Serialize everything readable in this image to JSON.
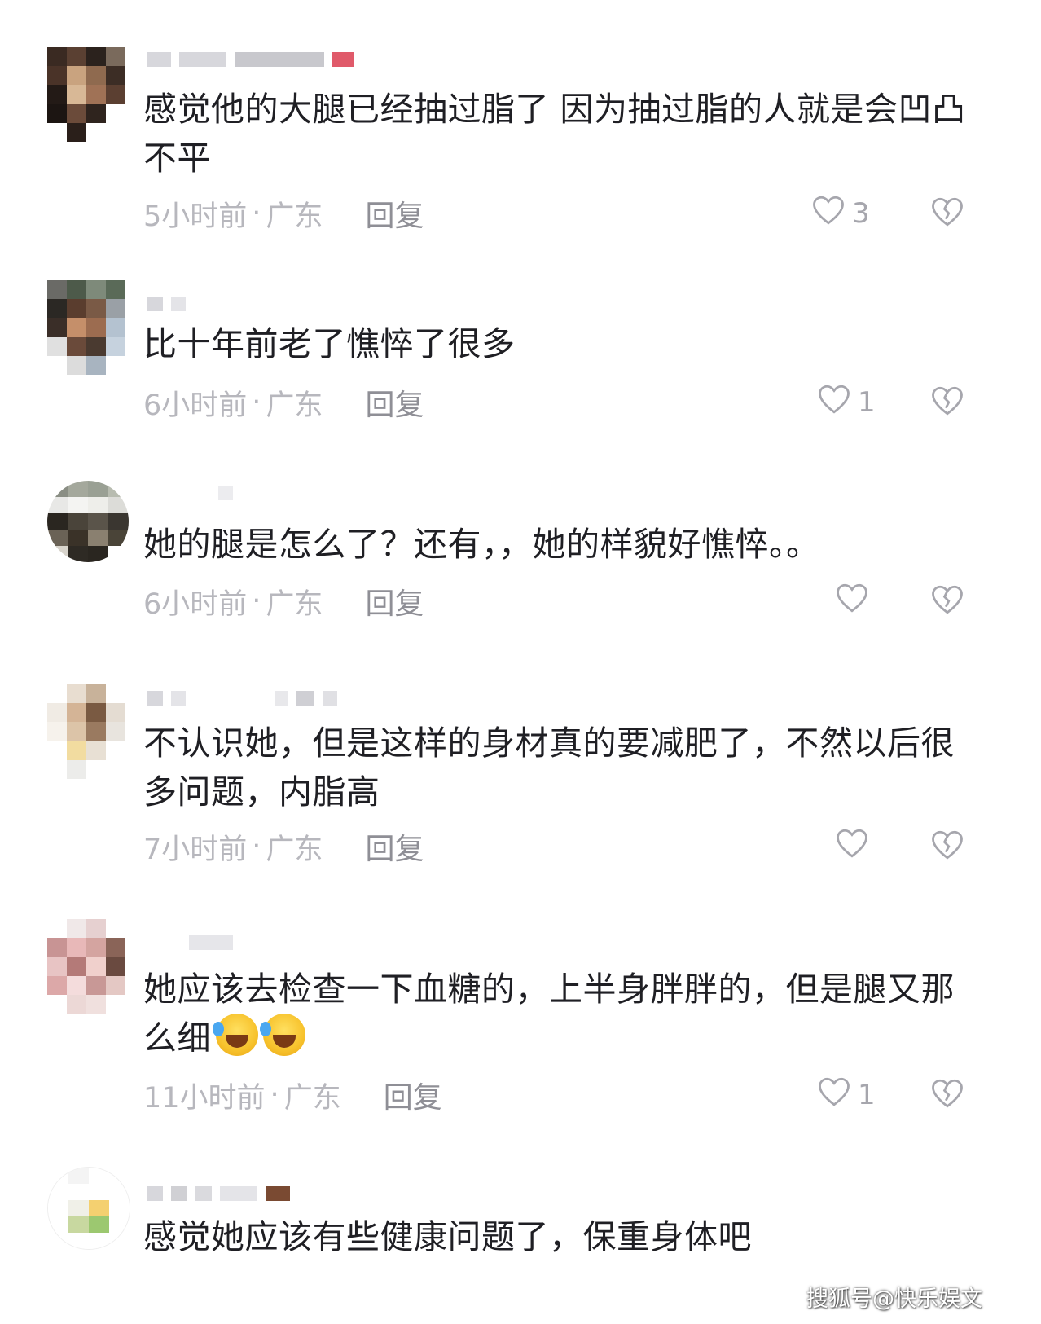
{
  "comments": [
    {
      "text": "感觉他的大腿已经抽过脂了 因为抽过脂的人就是会凹凸不平",
      "time": "5小时前",
      "location": "广东",
      "reply_label": "回复",
      "like_count": "3"
    },
    {
      "text": "比十年前老了憔悴了很多",
      "time": "6小时前",
      "location": "广东",
      "reply_label": "回复",
      "like_count": "1"
    },
    {
      "text": "她的腿是怎么了？还有，，她的样貌好憔悴。。",
      "time": "6小时前",
      "location": "广东",
      "reply_label": "回复",
      "like_count": ""
    },
    {
      "text": "不认识她，但是这样的身材真的要减肥了，不然以后很多问题，内脂高",
      "time": "7小时前",
      "location": "广东",
      "reply_label": "回复",
      "like_count": ""
    },
    {
      "text": "她应该去检查一下血糖的，上半身胖胖的，但是腿又那么细",
      "time": "11小时前",
      "location": "广东",
      "reply_label": "回复",
      "like_count": "1"
    },
    {
      "text": "感觉她应该有些健康问题了，保重身体吧",
      "time": "",
      "location": "",
      "reply_label": "",
      "like_count": ""
    }
  ],
  "meta_separator": "·",
  "watermark": "搜狐号@快乐娱文",
  "icons": {
    "like": "heart-outline-icon",
    "dislike": "broken-heart-icon",
    "emoji": "rolling-laughing-emoji"
  },
  "colors": {
    "text": "#1f1f24",
    "meta": "#b7b7bd",
    "reply": "#8f8f96",
    "icon": "#a6a6ad"
  }
}
